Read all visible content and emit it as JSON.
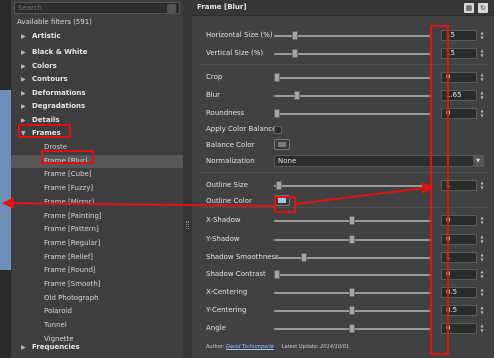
{
  "search": {
    "placeholder": "Search"
  },
  "tree": {
    "header": "Available filters (591)",
    "categories": [
      {
        "label": "Artistic"
      },
      {
        "label": "Black & White"
      },
      {
        "label": "Colors"
      },
      {
        "label": "Contours"
      },
      {
        "label": "Deformations"
      },
      {
        "label": "Degradations"
      },
      {
        "label": "Details"
      },
      {
        "label": "Frames"
      },
      {
        "label": "Frequencies"
      }
    ],
    "frames_children": [
      {
        "label": "Droste"
      },
      {
        "label": "Frame [Blur]"
      },
      {
        "label": "Frame [Cube]"
      },
      {
        "label": "Frame [Fuzzy]"
      },
      {
        "label": "Frame [Mirror]"
      },
      {
        "label": "Frame [Painting]"
      },
      {
        "label": "Frame [Pattern]"
      },
      {
        "label": "Frame [Regular]"
      },
      {
        "label": "Frame [Relief]"
      },
      {
        "label": "Frame [Round]"
      },
      {
        "label": "Frame [Smooth]"
      },
      {
        "label": "Old Photograph"
      },
      {
        "label": "Polaroid"
      },
      {
        "label": "Tunnel"
      },
      {
        "label": "Vignette"
      }
    ],
    "selected": "Frame [Blur]"
  },
  "panel": {
    "title": "Frame [Blur]",
    "params": [
      {
        "label": "Horizontal Size (%)",
        "value": "15",
        "level": 0.12
      },
      {
        "label": "Vertical Size (%)",
        "value": "15",
        "level": 0.12
      },
      {
        "label": "Crop",
        "value": "0",
        "level": 0.0
      },
      {
        "label": "Blur",
        "value": "1.65",
        "level": 0.13
      },
      {
        "label": "Roundness",
        "value": "0",
        "level": 0.0
      },
      {
        "label": "Apply Color Balance"
      },
      {
        "label": "Balance Color"
      },
      {
        "label": "Normalization",
        "value": "None"
      },
      {
        "label": "Outline Size",
        "value": "1",
        "level": 0.01
      },
      {
        "label": "Outline Color"
      },
      {
        "label": "X-Shadow",
        "value": "0",
        "level": 0.5
      },
      {
        "label": "Y-Shadow",
        "value": "0",
        "level": 0.5
      },
      {
        "label": "Shadow Smoothness",
        "value": "1",
        "level": 0.18
      },
      {
        "label": "Shadow Contrast",
        "value": "0",
        "level": 0.0
      },
      {
        "label": "X-Centering",
        "value": "0.5",
        "level": 0.5
      },
      {
        "label": "Y-Centering",
        "value": "0.5",
        "level": 0.5
      },
      {
        "label": "Angle",
        "value": "0",
        "level": 0.5
      }
    ],
    "footer": {
      "author_label": "Author:",
      "author": "David Tschumperlé",
      "update_label": "Latest Update:",
      "update": "2014/10/01."
    }
  },
  "colors": {
    "annotation": "#e01414",
    "outline_swatch": "#a9c3e6",
    "balance_swatch": "#7a7a7a",
    "link": "#9ec4ff"
  },
  "icons": [
    "search-icon",
    "expand-arrow-icon",
    "collapse-arrow-icon",
    "panel-icon",
    "refresh-icon",
    "chevron-down-icon"
  ]
}
